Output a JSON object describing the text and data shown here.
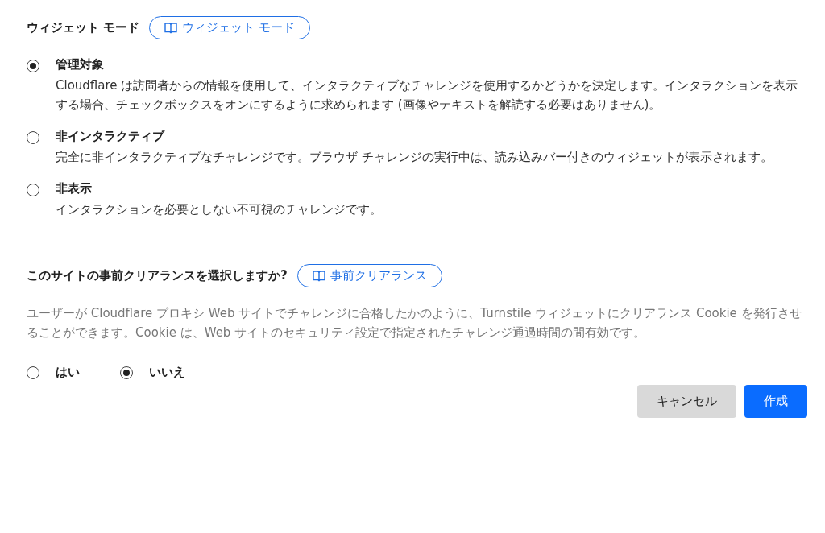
{
  "widget_mode": {
    "heading": "ウィジェット モード",
    "doc_link": "ウィジェット モード",
    "options": [
      {
        "label": "管理対象",
        "description": "Cloudflare は訪問者からの情報を使用して、インタラクティブなチャレンジを使用するかどうかを決定します。インタラクションを表示する場合、チェックボックスをオンにするように求められます (画像やテキストを解読する必要はありません)。",
        "selected": true
      },
      {
        "label": "非インタラクティブ",
        "description": "完全に非インタラクティブなチャレンジです。ブラウザ チャレンジの実行中は、読み込みバー付きのウィジェットが表示されます。",
        "selected": false
      },
      {
        "label": "非表示",
        "description": "インタラクションを必要としない不可視のチャレンジです。",
        "selected": false
      }
    ]
  },
  "pre_clearance": {
    "heading": "このサイトの事前クリアランスを選択しますか?",
    "doc_link": "事前クリアランス",
    "description": "ユーザーが Cloudflare プロキシ Web サイトでチャレンジに合格したかのように、Turnstile ウィジェットにクリアランス Cookie を発行させることができます。Cookie は、Web サイトのセキュリティ設定で指定されたチャレンジ通過時間の間有効です。",
    "options": [
      {
        "label": "はい",
        "selected": false
      },
      {
        "label": "いいえ",
        "selected": true
      }
    ]
  },
  "buttons": [
    {
      "label": "キャンセル",
      "kind": "secondary"
    },
    {
      "label": "作成",
      "kind": "primary"
    }
  ]
}
